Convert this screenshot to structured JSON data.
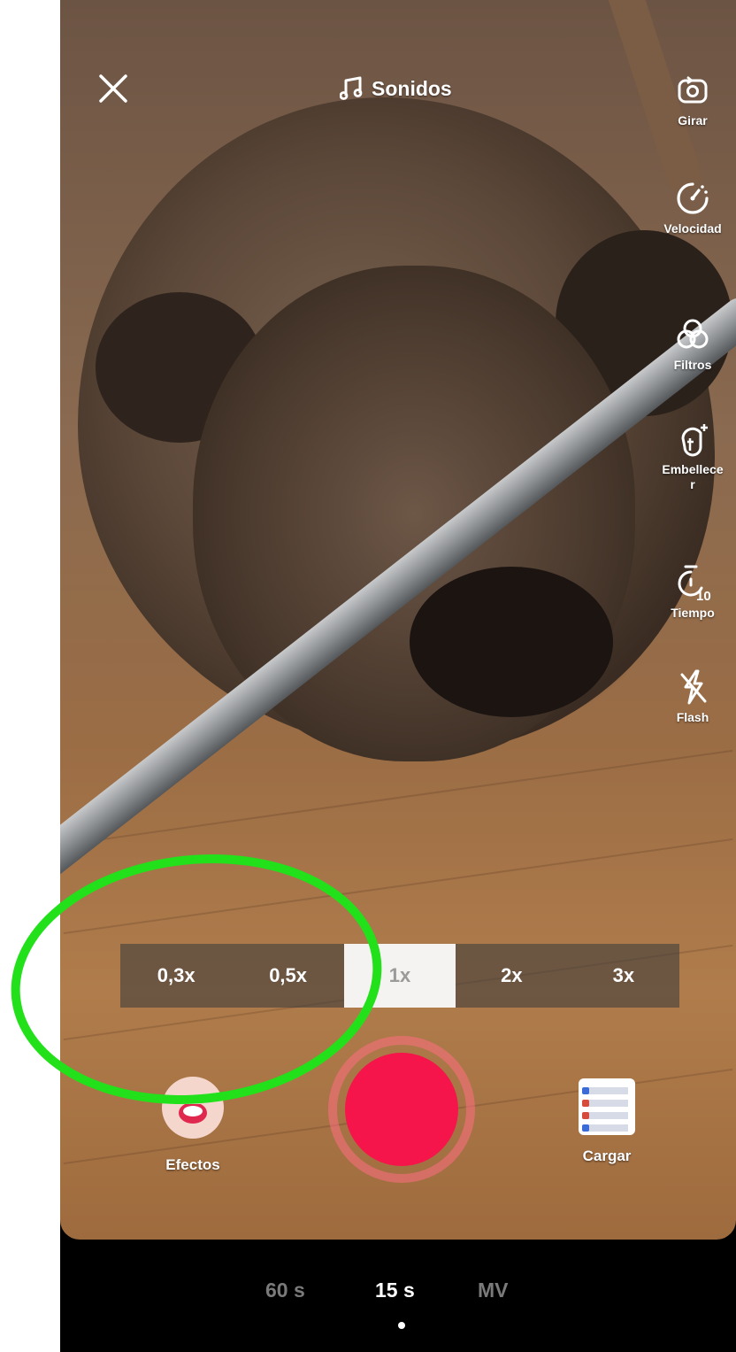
{
  "header": {
    "close_icon": "close-icon",
    "sounds_label": "Sonidos",
    "sounds_icon": "music-note-icon"
  },
  "side_tools": [
    {
      "label": "Girar",
      "icon": "flip-camera-icon"
    },
    {
      "label": "Velocidad",
      "icon": "speed-gauge-icon"
    },
    {
      "label": "Filtros",
      "icon": "filters-icon"
    },
    {
      "label": "Embellecer",
      "icon": "beautify-icon"
    },
    {
      "label": "Tiempo",
      "icon": "timer-icon"
    },
    {
      "label": "Flash",
      "icon": "flash-off-icon"
    }
  ],
  "zoom": {
    "options": [
      "0,3x",
      "0,5x",
      "1x",
      "2x",
      "3x"
    ],
    "selected": "1x"
  },
  "bottom_controls": {
    "effects_label": "Efectos",
    "upload_label": "Cargar"
  },
  "modes": {
    "items": [
      "60 s",
      "15 s",
      "MV"
    ],
    "selected": "15 s"
  },
  "colors": {
    "record": "#f5154b",
    "highlight": "#22e11a"
  }
}
